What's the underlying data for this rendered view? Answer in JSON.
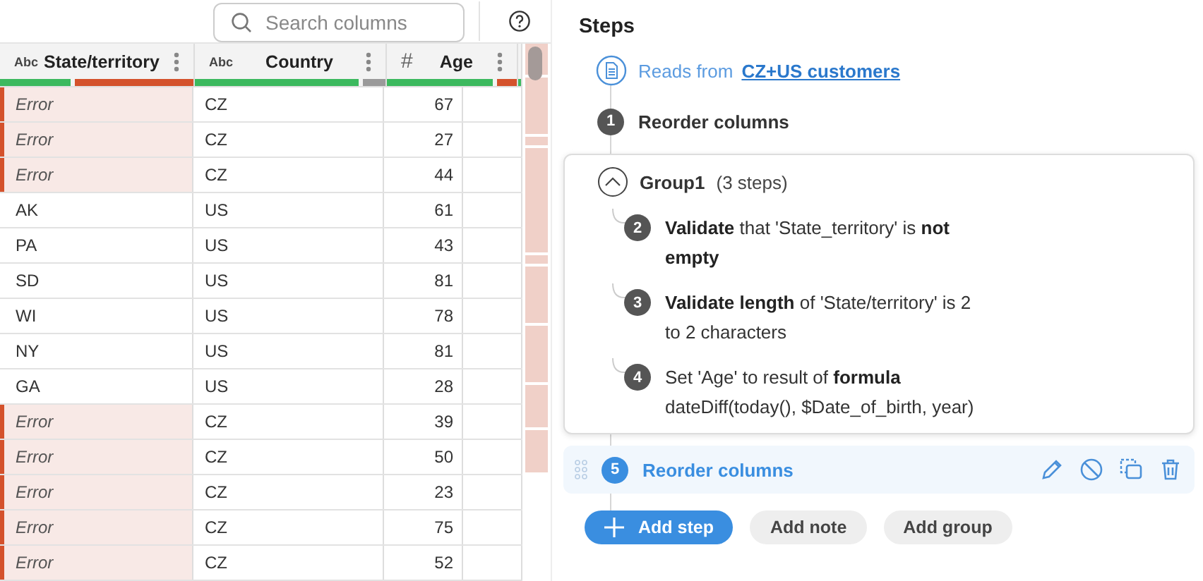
{
  "toolbar": {
    "search": {
      "placeholder": "Search columns"
    }
  },
  "table": {
    "columns": [
      {
        "name": "State/territory",
        "kind": "text",
        "type_label": "Abc",
        "quality": [
          {
            "kind": "valid",
            "level": 0.37
          },
          {
            "kind": "invalid",
            "level": 0.63
          }
        ]
      },
      {
        "name": "Country",
        "kind": "text",
        "type_label": "Abc",
        "quality": [
          {
            "kind": "valid",
            "level": 0.88
          },
          {
            "kind": "missing",
            "level": 0.12
          }
        ]
      },
      {
        "name": "Age",
        "kind": "number",
        "type_label": "#",
        "quality": [
          {
            "kind": "valid",
            "level": 0.84
          },
          {
            "kind": "invalid",
            "level": 0.16
          }
        ]
      }
    ],
    "rows": [
      {
        "error": true,
        "cells": [
          "Error",
          "CZ",
          "67"
        ]
      },
      {
        "error": true,
        "cells": [
          "Error",
          "CZ",
          "27"
        ]
      },
      {
        "error": true,
        "cells": [
          "Error",
          "CZ",
          "44"
        ]
      },
      {
        "error": false,
        "cells": [
          "AK",
          "US",
          "61"
        ]
      },
      {
        "error": false,
        "cells": [
          "PA",
          "US",
          "43"
        ]
      },
      {
        "error": false,
        "cells": [
          "SD",
          "US",
          "81"
        ]
      },
      {
        "error": false,
        "cells": [
          "WI",
          "US",
          "78"
        ]
      },
      {
        "error": false,
        "cells": [
          "NY",
          "US",
          "81"
        ]
      },
      {
        "error": false,
        "cells": [
          "GA",
          "US",
          "28"
        ]
      },
      {
        "error": true,
        "cells": [
          "Error",
          "CZ",
          "39"
        ]
      },
      {
        "error": true,
        "cells": [
          "Error",
          "CZ",
          "50"
        ]
      },
      {
        "error": true,
        "cells": [
          "Error",
          "CZ",
          "23"
        ]
      },
      {
        "error": true,
        "cells": [
          "Error",
          "CZ",
          "75"
        ]
      },
      {
        "error": true,
        "cells": [
          "Error",
          "CZ",
          "52"
        ]
      }
    ]
  },
  "steps_panel": {
    "title": "Steps",
    "source": {
      "prefix": "Reads from",
      "link": "CZ+US customers"
    },
    "items": [
      {
        "kind": "step",
        "number": "1",
        "text": "Reorder columns",
        "selected": false
      },
      {
        "kind": "group",
        "name": "Group1",
        "count": "(3 steps)",
        "expanded": true,
        "children": [
          {
            "kind": "step",
            "number": "2",
            "text": "**Validate** that 'State_territory' is **not empty**",
            "selected": false
          },
          {
            "kind": "step",
            "number": "3",
            "text": "**Validate length** of 'State/territory' is 2 to 2 characters",
            "selected": false
          },
          {
            "kind": "step",
            "number": "4",
            "text": "Set 'Age' to result of **formula** dateDiff(today(), $Date_of_birth, year)",
            "selected": false
          }
        ]
      },
      {
        "kind": "step",
        "number": "5",
        "text": "Reorder columns",
        "selected": true
      }
    ],
    "buttons": [
      {
        "label": "Add step",
        "primary": true
      },
      {
        "label": "Add note",
        "primary": false
      },
      {
        "label": "Add group",
        "primary": false
      }
    ]
  }
}
